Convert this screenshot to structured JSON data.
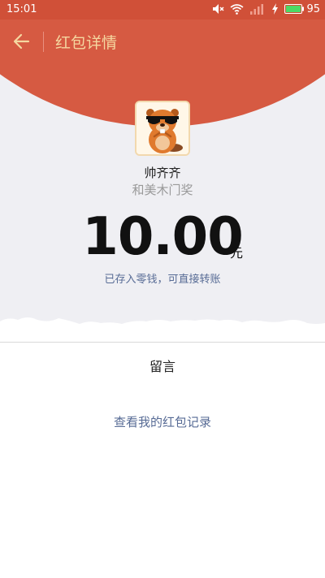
{
  "status_bar": {
    "time": "15:01",
    "battery_level": "95",
    "icons": [
      "mute-icon",
      "wifi-icon",
      "signal-icon",
      "charging-icon",
      "battery-icon"
    ]
  },
  "header": {
    "back_icon": "arrow-left-icon",
    "title": "红包详情"
  },
  "colors": {
    "header_red": "#d65a42",
    "title_gold": "#f5d7a0",
    "link_blue": "#576b95",
    "background_gray": "#efeff3"
  },
  "sender": {
    "avatar_icon": "beaver-with-sunglasses-avatar",
    "name": "帅齐齐",
    "greeting": "和美木门奖"
  },
  "amount": {
    "value": "10.00",
    "unit": "元"
  },
  "note": "已存入零钱，可直接转账",
  "message_label": "留言",
  "records_link": "查看我的红包记录"
}
